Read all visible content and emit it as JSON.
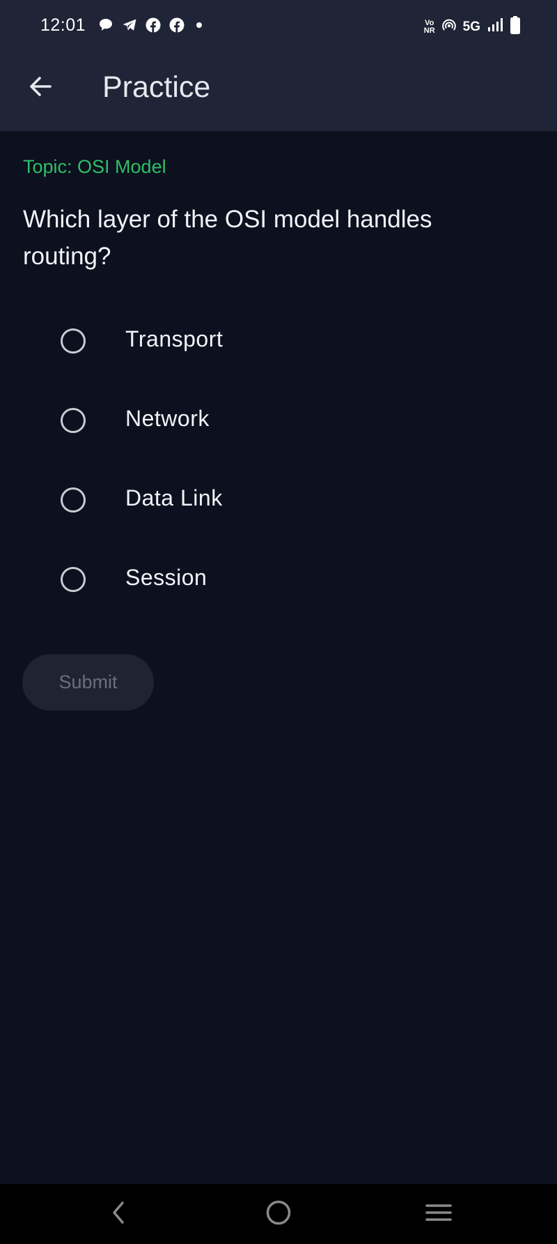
{
  "status_bar": {
    "time": "12:01",
    "network_label": "5G",
    "vonr_top": "Vo",
    "vonr_bottom": "NR",
    "icons": [
      "chat-bubble-icon",
      "telegram-icon",
      "facebook-icon",
      "facebook-icon",
      "dot-icon",
      "hotspot-icon",
      "signal-icon",
      "battery-icon"
    ]
  },
  "app_bar": {
    "title": "Practice",
    "back_icon": "arrow-left-icon"
  },
  "quiz": {
    "topic": "Topic: OSI Model",
    "question": "Which layer of the OSI model handles routing?",
    "options": [
      {
        "label": "Transport",
        "selected": false
      },
      {
        "label": "Network",
        "selected": false
      },
      {
        "label": "Data Link",
        "selected": false
      },
      {
        "label": "Session",
        "selected": false
      }
    ],
    "submit_label": "Submit",
    "submit_enabled": false
  },
  "nav_bar": {
    "icons": [
      "nav-back-icon",
      "nav-home-icon",
      "nav-recents-icon"
    ]
  },
  "colors": {
    "background": "#0c101f",
    "app_bar": "#1f2436",
    "topic_accent": "#2fbf66",
    "submit_disabled_bg": "#1f2332",
    "submit_disabled_text": "#6a6e7d"
  }
}
